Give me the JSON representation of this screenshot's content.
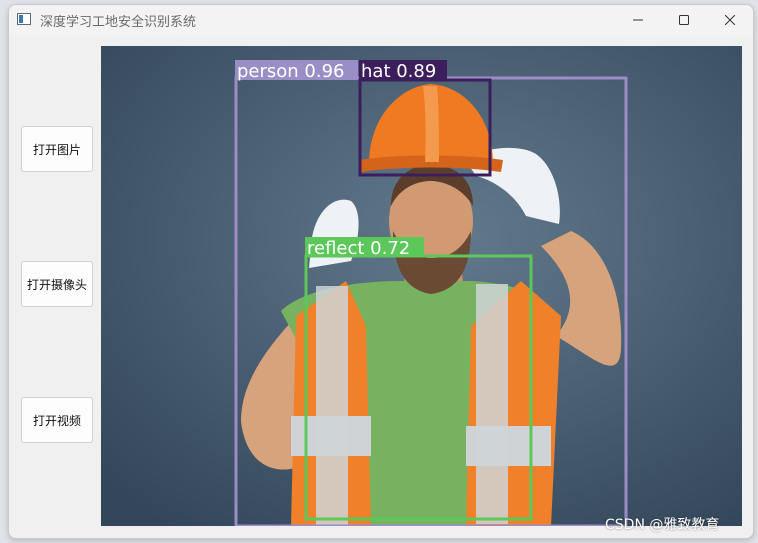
{
  "window": {
    "title": "深度学习工地安全识别系统"
  },
  "sidebar": {
    "buttons": [
      {
        "label": "打开图片"
      },
      {
        "label": "打开摄像头"
      },
      {
        "label": "打开视频"
      }
    ]
  },
  "detections": [
    {
      "label": "person 0.96",
      "color": "#9b8ec6"
    },
    {
      "label": "hat 0.89",
      "color": "#3c1e5c"
    },
    {
      "label": "reflect 0.72",
      "color": "#5cc85a"
    }
  ],
  "watermark": "CSDN @雅致教育"
}
